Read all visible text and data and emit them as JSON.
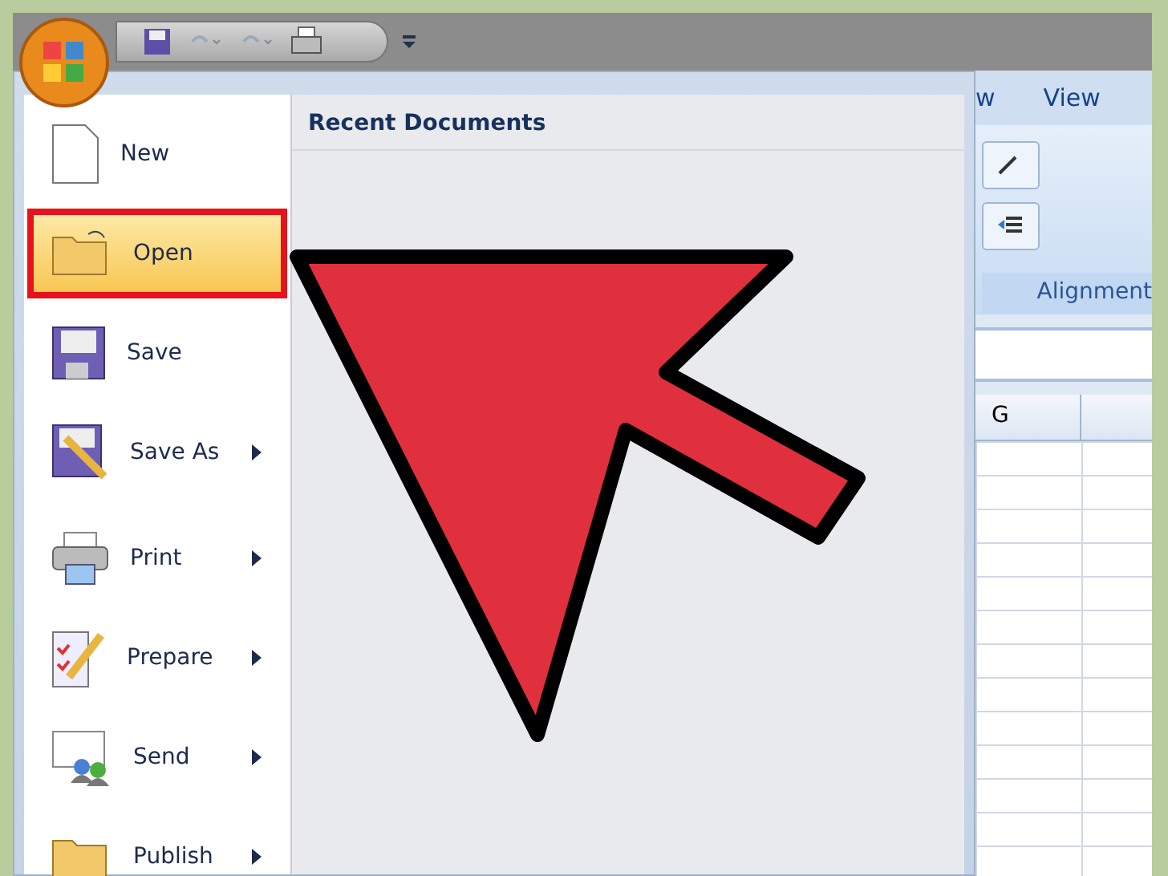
{
  "menu": {
    "items": [
      {
        "label": "New",
        "selected": false,
        "submenu": false
      },
      {
        "label": "Open",
        "selected": true,
        "submenu": false
      },
      {
        "label": "Save",
        "selected": false,
        "submenu": false
      },
      {
        "label": "Save As",
        "selected": false,
        "submenu": true
      },
      {
        "label": "Print",
        "selected": false,
        "submenu": true
      },
      {
        "label": "Prepare",
        "selected": false,
        "submenu": true
      },
      {
        "label": "Send",
        "selected": false,
        "submenu": true
      },
      {
        "label": "Publish",
        "selected": false,
        "submenu": true
      }
    ]
  },
  "recent_documents": {
    "title": "Recent Documents"
  },
  "ribbon": {
    "tabs": [
      {
        "label": "w"
      },
      {
        "label": "View"
      }
    ],
    "group": {
      "label": "Alignment"
    }
  },
  "sheet": {
    "columns": [
      "G"
    ]
  }
}
